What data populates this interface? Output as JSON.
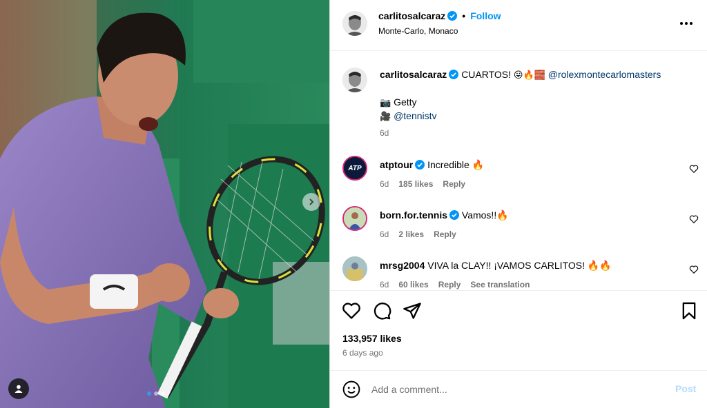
{
  "post": {
    "author": "carlitosalcaraz",
    "follow_label": "Follow",
    "location": "Monte-Carlo, Monaco",
    "separator": "•",
    "more_label": "•••"
  },
  "caption": {
    "username": "carlitosalcaraz",
    "text": "CUARTOS!",
    "emojis": "😛🔥🧱",
    "mention": "@rolexmontecarlomasters",
    "photo_credit_icon": "📷",
    "photo_credit": "Getty",
    "video_credit_icon": "🎥",
    "video_credit": "@tennistv",
    "time": "6d"
  },
  "comments": [
    {
      "username": "atptour",
      "verified": true,
      "text": "Incredible 🔥",
      "time": "6d",
      "likes": "185 likes",
      "reply": "Reply",
      "avatar_text": "ATP TOUR"
    },
    {
      "username": "born.for.tennis",
      "verified": true,
      "text": "Vamos!!🔥",
      "time": "6d",
      "likes": "2 likes",
      "reply": "Reply"
    },
    {
      "username": "mrsg2004",
      "verified": false,
      "text": "VIVA la CLAY!! ¡VAMOS CARLITOS! 🔥🔥",
      "time": "6d",
      "likes": "60 likes",
      "reply": "Reply",
      "translate": "See translation"
    }
  ],
  "stats": {
    "likes": "133,957 likes",
    "posted": "6 days ago"
  },
  "add_comment": {
    "placeholder": "Add a comment...",
    "post_label": "Post"
  },
  "carousel": {
    "slides": 3,
    "active": 0
  },
  "colors": {
    "accent": "#0095f6",
    "verified": "#0095f6",
    "post_disabled": "#b3dbff",
    "muted": "#737373"
  },
  "icons": [
    "verified-badge-icon",
    "more-options-icon",
    "heart-icon",
    "comment-icon",
    "share-icon",
    "bookmark-icon",
    "emoji-icon",
    "chevron-right-icon",
    "user-tag-icon"
  ]
}
